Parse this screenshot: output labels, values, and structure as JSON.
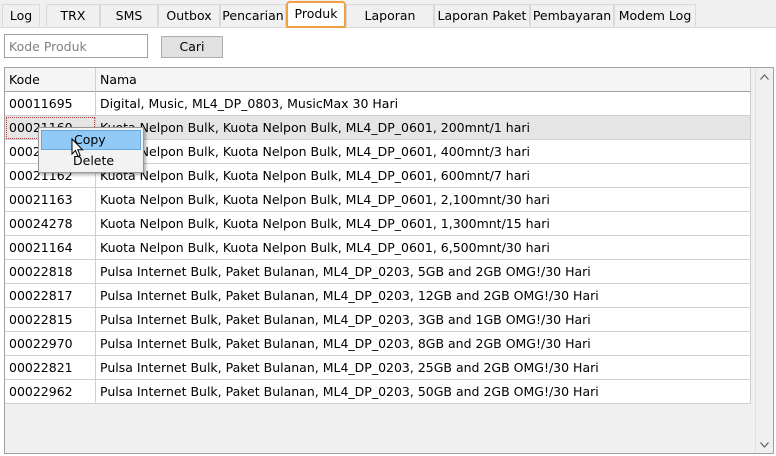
{
  "tabs": [
    {
      "label": "Log",
      "active": false
    },
    {
      "label": "TRX",
      "active": false
    },
    {
      "label": "SMS",
      "active": false
    },
    {
      "label": "Outbox",
      "active": false
    },
    {
      "label": "Pencarian",
      "active": false
    },
    {
      "label": "Produk",
      "active": true
    },
    {
      "label": "Laporan Pulsa",
      "active": false
    },
    {
      "label": "Laporan Paket",
      "active": false
    },
    {
      "label": "Pembayaran",
      "active": false
    },
    {
      "label": "Modem Log",
      "active": false
    }
  ],
  "search": {
    "placeholder": "Kode Produk",
    "value": "",
    "button_label": "Cari"
  },
  "table": {
    "columns": [
      "Kode",
      "Nama"
    ],
    "rows": [
      {
        "kode": "00011695",
        "nama": "Digital, Music, ML4_DP_0803, MusicMax 30 Hari"
      },
      {
        "kode": "00021160",
        "nama": "Kuota Nelpon Bulk, Kuota Nelpon Bulk, ML4_DP_0601, 200mnt/1 hari"
      },
      {
        "kode": "00021161",
        "nama": "Kuota Nelpon Bulk, Kuota Nelpon Bulk, ML4_DP_0601, 400mnt/3 hari"
      },
      {
        "kode": "00021162",
        "nama": "Kuota Nelpon Bulk, Kuota Nelpon Bulk, ML4_DP_0601, 600mnt/7 hari"
      },
      {
        "kode": "00021163",
        "nama": "Kuota Nelpon Bulk, Kuota Nelpon Bulk, ML4_DP_0601, 2,100mnt/30 hari"
      },
      {
        "kode": "00024278",
        "nama": "Kuota Nelpon Bulk, Kuota Nelpon Bulk, ML4_DP_0601, 1,300mnt/15 hari"
      },
      {
        "kode": "00021164",
        "nama": "Kuota Nelpon Bulk, Kuota Nelpon Bulk, ML4_DP_0601, 6,500mnt/30 hari"
      },
      {
        "kode": "00022818",
        "nama": "Pulsa Internet Bulk, Paket Bulanan, ML4_DP_0203, 5GB and 2GB OMG!/30 Hari"
      },
      {
        "kode": "00022817",
        "nama": "Pulsa Internet Bulk, Paket Bulanan, ML4_DP_0203, 12GB and 2GB OMG!/30 Hari"
      },
      {
        "kode": "00022815",
        "nama": "Pulsa Internet Bulk, Paket Bulanan, ML4_DP_0203, 3GB and 1GB OMG!/30 Hari"
      },
      {
        "kode": "00022970",
        "nama": "Pulsa Internet Bulk, Paket Bulanan, ML4_DP_0203, 8GB and 2GB OMG!/30 Hari"
      },
      {
        "kode": "00022821",
        "nama": "Pulsa Internet Bulk, Paket Bulanan, ML4_DP_0203, 25GB and 2GB OMG!/30 Hari"
      },
      {
        "kode": "00022962",
        "nama": "Pulsa Internet Bulk, Paket Bulanan, ML4_DP_0203, 50GB and 2GB OMG!/30 Hari"
      }
    ]
  },
  "context_menu": {
    "items": [
      "Copy",
      "Delete"
    ],
    "highlighted": "Copy"
  },
  "icons": {
    "scroll_up": "scroll-up-arrow-icon",
    "scroll_down": "scroll-down-arrow-icon",
    "cursor": "mouse-pointer-icon"
  },
  "colors": {
    "active_tab_border": "#f0a040",
    "menu_highlight": "#91c9f7",
    "selected_row": "#e5e5e5"
  }
}
